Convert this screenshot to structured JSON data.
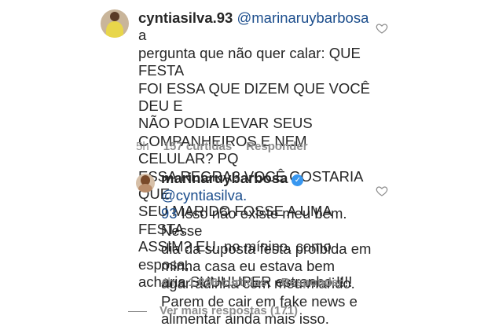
{
  "comments": [
    {
      "username": "cyntiasilva.93",
      "mention": "@marinaruybarbosa",
      "text_first": " a",
      "text_rest": "pergunta que não quer calar: QUE FESTA\nFOI ESSA QUE DIZEM QUE VOCÊ DEU E\nNÃO PODIA LEVAR SEUS\nCOMPANHEIROS E NEM CELULAR? PQ\nESSA REGRA? VOCÊ GOSTARIA QUE\nSEU MARIDO FOSSE A UMA FESTA\nASSIM? EU, no mínino, como esposa,\nacharia SUUUUPER estranho !!!!",
      "time": "5h",
      "likes": "157 curtidas",
      "reply_label": "Responder"
    },
    {
      "username": "marinaruybarbosa",
      "verified": true,
      "mention_part1": "@cyntiasilva.",
      "mention_part2": "93",
      "text_first": " Isso não existe meu bem. Nesse",
      "text_rest": "dia da suposta festa proibida em\nminha casa eu estava bem\nagarradinha com meu marido.\nParem de cair em fake news e\nalimentar ainda mais isso.",
      "time": "4h",
      "likes": "1.826 curtidas",
      "reply_label": "Responder"
    }
  ],
  "view_more_label": "Ver mais respostas (171)",
  "icons": {
    "like": "heart-outline-icon",
    "verified": "verified-badge-icon"
  },
  "colors": {
    "text": "#262626",
    "muted": "#8e8e8e",
    "mention": "#1b4d8c",
    "verified": "#3897f0"
  }
}
